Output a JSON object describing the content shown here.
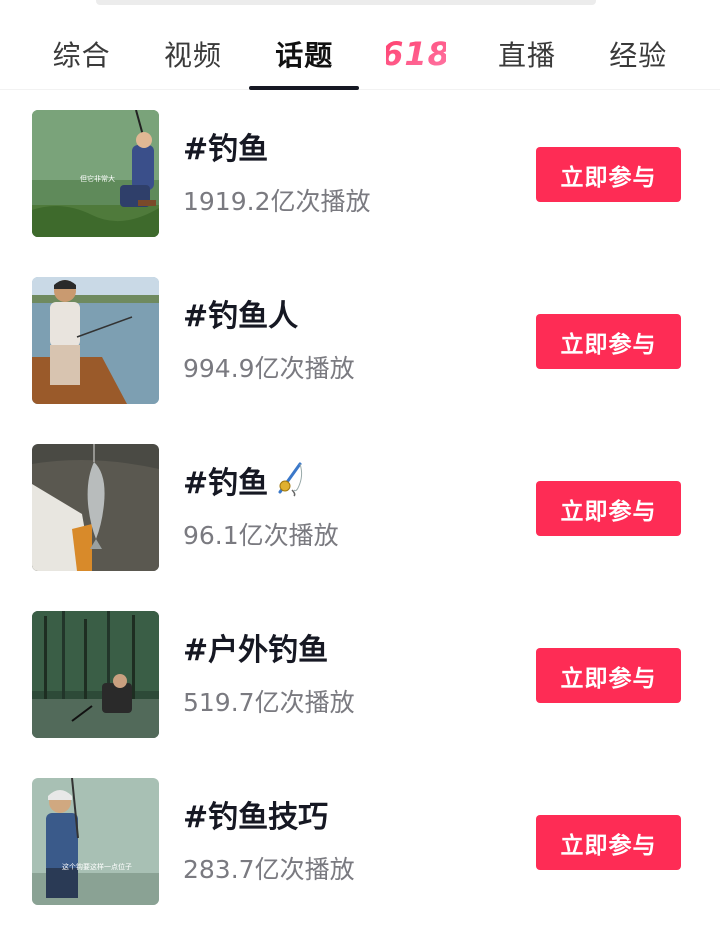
{
  "tabs": [
    {
      "label": "综合"
    },
    {
      "label": "视频"
    },
    {
      "label": "话题",
      "active": true
    },
    {
      "label": "618"
    },
    {
      "label": "直播"
    },
    {
      "label": "经验"
    }
  ],
  "colors": {
    "accent": "#fe2c55",
    "tab_618_gradient": [
      "#ff3b6b",
      "#ff7aa8"
    ],
    "muted_text": "#7a7a80"
  },
  "topics": [
    {
      "title": "#钓鱼",
      "plays": "1919.2亿次播放",
      "button": "立即参与",
      "thumb_caption": "但它非常大"
    },
    {
      "title": "#钓鱼人",
      "plays": "994.9亿次播放",
      "button": "立即参与"
    },
    {
      "title": "#钓鱼",
      "emoji": "fishing-rod-icon",
      "plays": "96.1亿次播放",
      "button": "立即参与"
    },
    {
      "title": "#户外钓鱼",
      "plays": "519.7亿次播放",
      "button": "立即参与"
    },
    {
      "title": "#钓鱼技巧",
      "plays": "283.7亿次播放",
      "button": "立即参与",
      "thumb_caption": "这个钩要这样一点位子"
    }
  ]
}
